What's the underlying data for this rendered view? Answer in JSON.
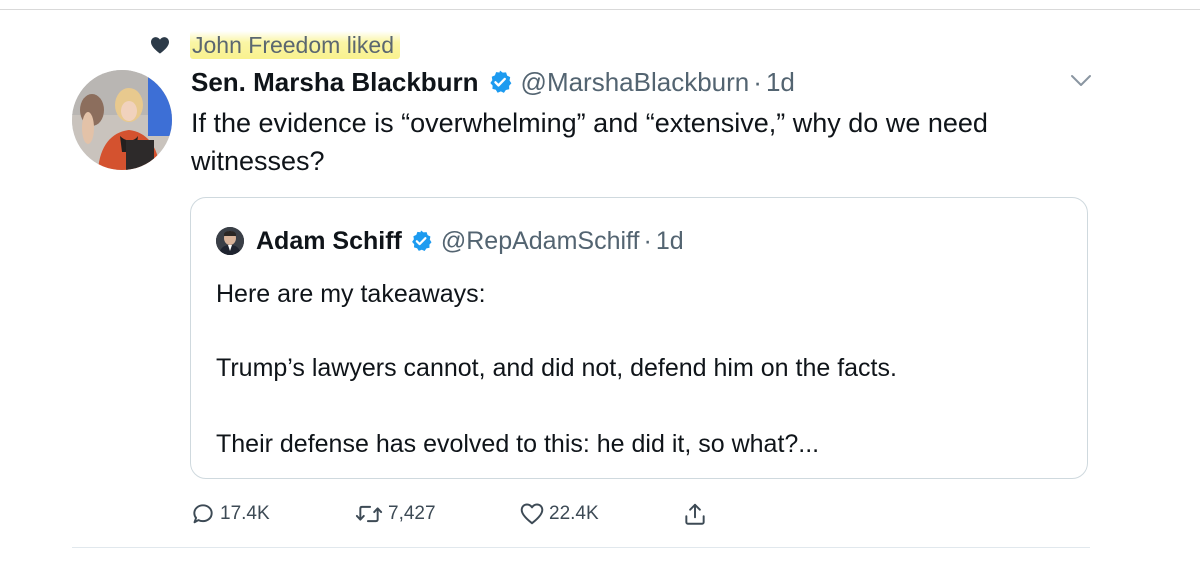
{
  "social_context": {
    "icon": "heart-icon",
    "text": "John Freedom liked"
  },
  "tweet": {
    "avatar": "avatar",
    "display_name": "Sen. Marsha Blackburn",
    "verified_icon": "verified-badge-icon",
    "handle": "@MarshaBlackburn",
    "separator": "·",
    "time": "1d",
    "menu_icon": "chevron-down-icon",
    "text": "If the evidence is “overwhelming” and “extensive,” why do we need witnesses?"
  },
  "quote": {
    "display_name": "Adam Schiff",
    "handle": "@RepAdamSchiff",
    "separator": "·",
    "time": "1d",
    "lines": [
      "Here are my takeaways:",
      "Trump’s lawyers cannot, and did not, defend him on the facts.",
      "Their defense has evolved to this: he did it, so what?..."
    ]
  },
  "actions": {
    "reply": {
      "icon": "reply-icon",
      "count": "17.4K"
    },
    "retweet": {
      "icon": "retweet-icon",
      "count": "7,427"
    },
    "like": {
      "icon": "heart-outline-icon",
      "count": "22.4K"
    },
    "share": {
      "icon": "share-icon"
    }
  },
  "colors": {
    "verified": "#1d9bf0",
    "secondary_text": "#536471",
    "highlight": "#f8f08a"
  }
}
